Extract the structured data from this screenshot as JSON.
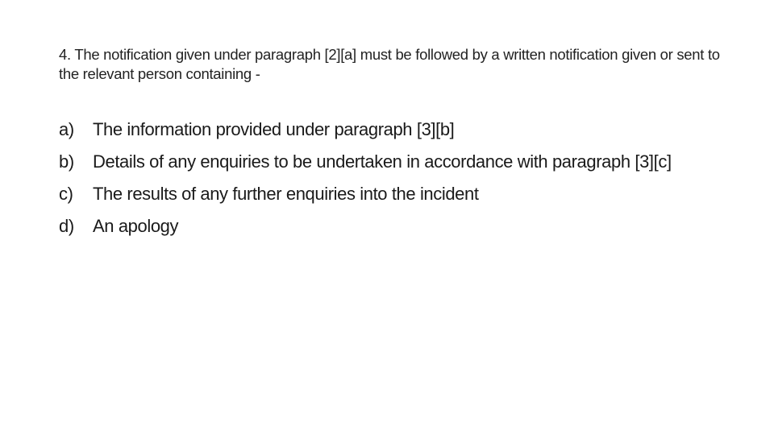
{
  "intro": {
    "text": "4.  The notification given under paragraph [2][a] must be followed by a written notification given or sent to the relevant person containing -"
  },
  "list": {
    "items": [
      {
        "marker": "a)",
        "text": "The information provided under paragraph [3][b]"
      },
      {
        "marker": "b)",
        "text": "Details of any enquiries to be undertaken in accordance with paragraph [3][c]"
      },
      {
        "marker": "c)",
        "text": "The results of any further enquiries into the incident"
      },
      {
        "marker": "d)",
        "text": "An apology"
      }
    ]
  }
}
